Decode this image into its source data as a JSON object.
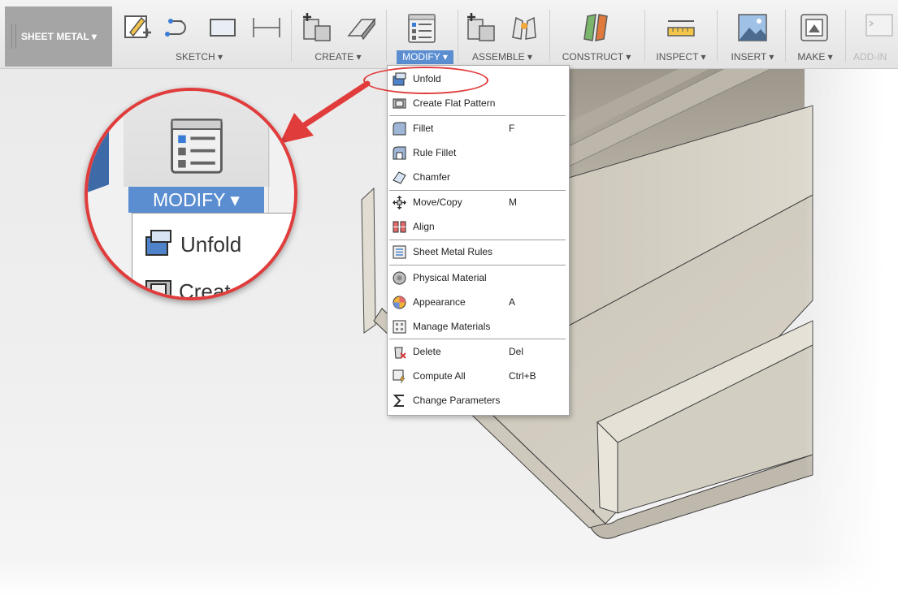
{
  "toolbar": {
    "workspace_label": "SHEET METAL ▾",
    "groups": [
      {
        "label": "SKETCH ▾"
      },
      {
        "label": "CREATE ▾"
      },
      {
        "label": "MODIFY ▾"
      },
      {
        "label": "ASSEMBLE ▾"
      },
      {
        "label": "CONSTRUCT ▾"
      },
      {
        "label": "INSPECT ▾"
      },
      {
        "label": "INSERT ▾"
      },
      {
        "label": "MAKE ▾"
      },
      {
        "label": "ADD-IN"
      }
    ]
  },
  "modify_menu": {
    "items": [
      {
        "label": "Unfold",
        "shortcut": "",
        "icon": "unfold-icon"
      },
      {
        "label": "Create Flat Pattern",
        "shortcut": "",
        "icon": "flat-pattern-icon"
      },
      {
        "label": "Fillet",
        "shortcut": "F",
        "icon": "fillet-icon"
      },
      {
        "label": "Rule Fillet",
        "shortcut": "",
        "icon": "rule-fillet-icon"
      },
      {
        "label": "Chamfer",
        "shortcut": "",
        "icon": "chamfer-icon"
      },
      {
        "label": "Move/Copy",
        "shortcut": "M",
        "icon": "move-copy-icon"
      },
      {
        "label": "Align",
        "shortcut": "",
        "icon": "align-icon"
      },
      {
        "label": "Sheet Metal Rules",
        "shortcut": "",
        "icon": "sheet-metal-rules-icon"
      },
      {
        "label": "Physical Material",
        "shortcut": "",
        "icon": "physical-material-icon"
      },
      {
        "label": "Appearance",
        "shortcut": "A",
        "icon": "appearance-icon"
      },
      {
        "label": "Manage Materials",
        "shortcut": "",
        "icon": "manage-materials-icon"
      },
      {
        "label": "Delete",
        "shortcut": "Del",
        "icon": "delete-icon"
      },
      {
        "label": "Compute All",
        "shortcut": "Ctrl+B",
        "icon": "compute-all-icon"
      },
      {
        "label": "Change Parameters",
        "shortcut": "",
        "icon": "sigma-icon"
      }
    ]
  },
  "magnifier": {
    "modify_label": "MODIFY ▾",
    "unfold_label": "Unfold",
    "partial_label": "Creat"
  },
  "colors": {
    "accent": "#5b8ed1",
    "callout": "#e13c3c",
    "sheet_metal": "#d6d0c4"
  }
}
